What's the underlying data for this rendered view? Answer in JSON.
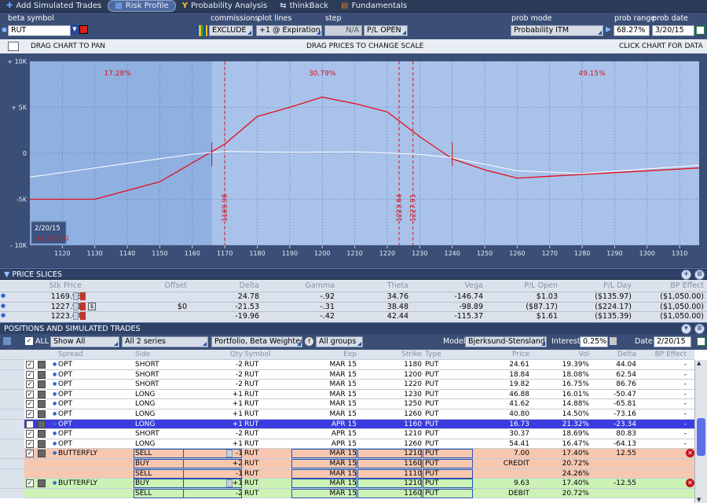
{
  "tabs": [
    {
      "label": "Add Simulated Trades",
      "icon": "plus-icon"
    },
    {
      "label": "Risk Profile",
      "icon": "risk-profile-icon",
      "active": true
    },
    {
      "label": "Probability Analysis",
      "icon": "probability-icon"
    },
    {
      "label": "thinkBack",
      "icon": "thinkback-icon"
    },
    {
      "label": "Fundamentals",
      "icon": "fundamentals-icon"
    }
  ],
  "controls": {
    "beta_symbol_label": "beta symbol",
    "symbol": "RUT",
    "commissions_label": "commissions",
    "commissions": "EXCLUDE",
    "plot_lines_label": "plot lines",
    "plot_lines": "+1 @ Expiration",
    "step_label": "step",
    "step": "N/A",
    "pl_mode": "P/L OPEN",
    "prob_mode_label": "prob mode",
    "prob_mode": "Probability ITM",
    "prob_range_label": "prob range",
    "prob_range": "68.27%",
    "prob_date_label": "prob date",
    "prob_date": "3/20/15"
  },
  "chartbar": {
    "left": "DRAG CHART TO PAN",
    "center": "DRAG PRICES TO CHANGE SCALE",
    "right": "CLICK CHART FOR DATA"
  },
  "chart_data": {
    "type": "line",
    "x_ticks": [
      1120,
      1130,
      1140,
      1150,
      1160,
      1170,
      1180,
      1190,
      1200,
      1210,
      1220,
      1230,
      1240,
      1250,
      1260,
      1270,
      1280,
      1290,
      1300,
      1310
    ],
    "y_ticks": [
      {
        "v": 10000,
        "label": "+ 10K"
      },
      {
        "v": 5000,
        "label": "+ 5K"
      },
      {
        "v": 0,
        "label": "0"
      },
      {
        "v": -5000,
        "label": "-5K"
      },
      {
        "v": -10000,
        "label": "- 10K"
      }
    ],
    "xlim": [
      1110,
      1316
    ],
    "ylim": [
      -10000,
      10000
    ],
    "series": [
      {
        "role": "expiration",
        "color": "#e0121a",
        "points": [
          [
            1110,
            -5000
          ],
          [
            1130,
            -5000
          ],
          [
            1150,
            -3100
          ],
          [
            1170,
            1000
          ],
          [
            1180,
            4000
          ],
          [
            1190,
            5000
          ],
          [
            1200,
            6100
          ],
          [
            1210,
            5400
          ],
          [
            1220,
            4500
          ],
          [
            1230,
            1800
          ],
          [
            1240,
            -600
          ],
          [
            1250,
            -1800
          ],
          [
            1260,
            -2700
          ],
          [
            1270,
            -2500
          ],
          [
            1316,
            -1600
          ]
        ]
      },
      {
        "role": "current",
        "color": "#ffffff",
        "points": [
          [
            1110,
            -2600
          ],
          [
            1130,
            -1600
          ],
          [
            1150,
            -600
          ],
          [
            1160,
            -100
          ],
          [
            1170,
            200
          ],
          [
            1190,
            100
          ],
          [
            1210,
            150
          ],
          [
            1230,
            -100
          ],
          [
            1240,
            -500
          ],
          [
            1260,
            -1900
          ],
          [
            1280,
            -2200
          ],
          [
            1316,
            -1300
          ]
        ]
      }
    ],
    "probabilities": [
      {
        "label": "17.28%",
        "x": 1137
      },
      {
        "label": "30.79%",
        "x": 1200
      },
      {
        "label": "49.15%",
        "x": 1283
      }
    ],
    "price_lines": [
      {
        "v": 1169.98,
        "label": "1169.98"
      },
      {
        "v": 1223.64,
        "label": "1223.64"
      },
      {
        "v": 1227.91,
        "label": "1227.91"
      }
    ],
    "range_band": [
      1110,
      1166
    ],
    "date_badge": "2/20/15",
    "date_badge_value": "-$1,050.00"
  },
  "slices": {
    "header": "PRICE SLICES",
    "columns": [
      "Stk Price",
      "Offset",
      "Delta",
      "Gamma",
      "Theta",
      "Vega",
      "P/L Open",
      "P/L Day",
      "BP Effect"
    ],
    "rows": [
      {
        "price": "1169.98",
        "offset": "",
        "delta": "24.78",
        "gamma": "-.92",
        "theta": "34.76",
        "vega": "-146.74",
        "pl_open": "$1.03",
        "pl_day": "($135.97)",
        "bp": "($1,050.00)"
      },
      {
        "price": "1227.91",
        "offset": "$0",
        "delta": "-21.53",
        "gamma": "-.31",
        "theta": "38.48",
        "vega": "-98.89",
        "pl_open": "($87.17)",
        "pl_day": "($224.17)",
        "bp": "($1,050.00)"
      },
      {
        "price": "1223.64",
        "offset": "",
        "delta": "-19.96",
        "gamma": "-.42",
        "theta": "42.44",
        "vega": "-115.37",
        "pl_open": "$1.61",
        "pl_day": "($135.39)",
        "bp": "($1,050.00)"
      }
    ]
  },
  "positions": {
    "header": "POSITIONS AND SIMULATED TRADES",
    "all_label": "ALL",
    "filter_show": "Show All",
    "filter_series": "All 2 series",
    "filter_portfolio": "Portfolio, Beta Weighted",
    "filter_groups": "All groups",
    "model_label": "Model",
    "model": "Bjerksund-Stensland",
    "interest_label": "Interest",
    "interest": "0.25%",
    "date_label": "Date",
    "date": "2/20/15",
    "columns": [
      "Spread",
      "Side",
      "Qty",
      "Symbol",
      "Exp",
      "Strike",
      "Type",
      "Price",
      "Vol",
      "Delta",
      "BP Effect"
    ],
    "rows": [
      {
        "spread": "OPT",
        "side": "SHORT",
        "qty": "-2",
        "sym": "RUT",
        "exp": "MAR 15",
        "strike": "1180",
        "type": "PUT",
        "price": "24.61",
        "vol": "19.39%",
        "delta": "44.04",
        "bp": "-",
        "style": "w"
      },
      {
        "spread": "OPT",
        "side": "SHORT",
        "qty": "-2",
        "sym": "RUT",
        "exp": "MAR 15",
        "strike": "1200",
        "type": "PUT",
        "price": "18.84",
        "vol": "18.08%",
        "delta": "62.54",
        "bp": "-",
        "style": "w"
      },
      {
        "spread": "OPT",
        "side": "SHORT",
        "qty": "-2",
        "sym": "RUT",
        "exp": "MAR 15",
        "strike": "1220",
        "type": "PUT",
        "price": "19.82",
        "vol": "16.75%",
        "delta": "86.76",
        "bp": "-",
        "style": "w"
      },
      {
        "spread": "OPT",
        "side": "LONG",
        "qty": "+1",
        "sym": "RUT",
        "exp": "MAR 15",
        "strike": "1230",
        "type": "PUT",
        "price": "46.88",
        "vol": "16.01%",
        "delta": "-50.47",
        "bp": "-",
        "style": "w"
      },
      {
        "spread": "OPT",
        "side": "LONG",
        "qty": "+1",
        "sym": "RUT",
        "exp": "MAR 15",
        "strike": "1250",
        "type": "PUT",
        "price": "41.62",
        "vol": "14.88%",
        "delta": "-65.81",
        "bp": "-",
        "style": "w"
      },
      {
        "spread": "OPT",
        "side": "LONG",
        "qty": "+1",
        "sym": "RUT",
        "exp": "MAR 15",
        "strike": "1260",
        "type": "PUT",
        "price": "40.80",
        "vol": "14.50%",
        "delta": "-73.16",
        "bp": "-",
        "style": "w"
      },
      {
        "spread": "OPT",
        "side": "LONG",
        "qty": "+1",
        "sym": "RUT",
        "exp": "APR 15",
        "strike": "1160",
        "type": "PUT",
        "price": "16.73",
        "vol": "21.32%",
        "delta": "-23.34",
        "bp": "-",
        "style": "sel"
      },
      {
        "spread": "OPT",
        "side": "SHORT",
        "qty": "-2",
        "sym": "RUT",
        "exp": "APR 15",
        "strike": "1210",
        "type": "PUT",
        "price": "30.37",
        "vol": "18.69%",
        "delta": "80.83",
        "bp": "-",
        "style": "w"
      },
      {
        "spread": "OPT",
        "side": "LONG",
        "qty": "+1",
        "sym": "RUT",
        "exp": "APR 15",
        "strike": "1260",
        "type": "PUT",
        "price": "54.41",
        "vol": "16.47%",
        "delta": "-64.13",
        "bp": "-",
        "style": "w"
      },
      {
        "spread": "BUTTERFLY",
        "side": "SELL",
        "qty": "-1",
        "sym": "RUT",
        "exp": "MAR 15",
        "strike": "1210",
        "type": "PUT",
        "price": "7.00",
        "vol": "17.40%",
        "delta": "12.55",
        "bp": "",
        "style": "red",
        "main": true
      },
      {
        "spread": "",
        "side": "BUY",
        "qty": "+2",
        "sym": "RUT",
        "exp": "MAR 15",
        "strike": "1160",
        "type": "PUT",
        "price": "CREDIT",
        "vol": "20.72%",
        "delta": "",
        "bp": "",
        "style": "red"
      },
      {
        "spread": "",
        "side": "SELL",
        "qty": "-1",
        "sym": "RUT",
        "exp": "MAR 15",
        "strike": "1110",
        "type": "PUT",
        "price": "",
        "vol": "24.26%",
        "delta": "",
        "bp": "",
        "style": "red"
      },
      {
        "spread": "BUTTERFLY",
        "side": "BUY",
        "qty": "+1",
        "sym": "RUT",
        "exp": "MAR 15",
        "strike": "1210",
        "type": "PUT",
        "price": "9.63",
        "vol": "17.40%",
        "delta": "-12.55",
        "bp": "",
        "style": "grn",
        "main": true
      },
      {
        "spread": "",
        "side": "SELL",
        "qty": "-2",
        "sym": "RUT",
        "exp": "MAR 15",
        "strike": "1160",
        "type": "PUT",
        "price": "DEBIT",
        "vol": "20.72%",
        "delta": "",
        "bp": "",
        "style": "grn"
      }
    ]
  }
}
